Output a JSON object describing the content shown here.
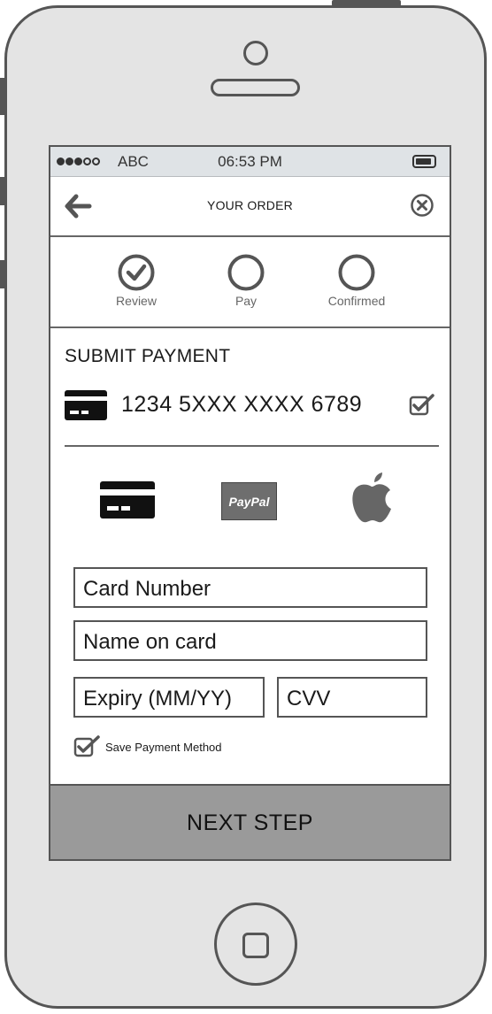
{
  "status_bar": {
    "carrier": "ABC",
    "time": "06:53 PM",
    "signal_bars_filled": 3,
    "signal_bars_total": 5
  },
  "header": {
    "title": "YOUR ORDER",
    "back_icon": "arrow-left-icon",
    "close_icon": "close-circle-icon"
  },
  "steps": [
    {
      "label": "Review",
      "state": "completed"
    },
    {
      "label": "Pay",
      "state": "pending"
    },
    {
      "label": "Confirmed",
      "state": "pending"
    }
  ],
  "payment": {
    "title": "SUBMIT PAYMENT",
    "saved_card": {
      "number": "1234 5XXX XXXX 6789",
      "selected": true
    }
  },
  "methods": [
    {
      "name": "credit-card",
      "icon": "credit-card-icon"
    },
    {
      "name": "paypal",
      "label": "PayPal"
    },
    {
      "name": "apple-pay",
      "icon": "apple-icon"
    }
  ],
  "form": {
    "card_number_placeholder": "Card Number",
    "name_placeholder": "Name on card",
    "expiry_placeholder": "Expiry (MM/YY)",
    "cvv_placeholder": "CVV",
    "save_method_label": "Save Payment Method",
    "save_method_checked": true
  },
  "footer": {
    "next_label": "NEXT STEP"
  },
  "colors": {
    "frame": "#555555",
    "status_bar": "#dfe3e6",
    "button": "#9a9a9a"
  }
}
